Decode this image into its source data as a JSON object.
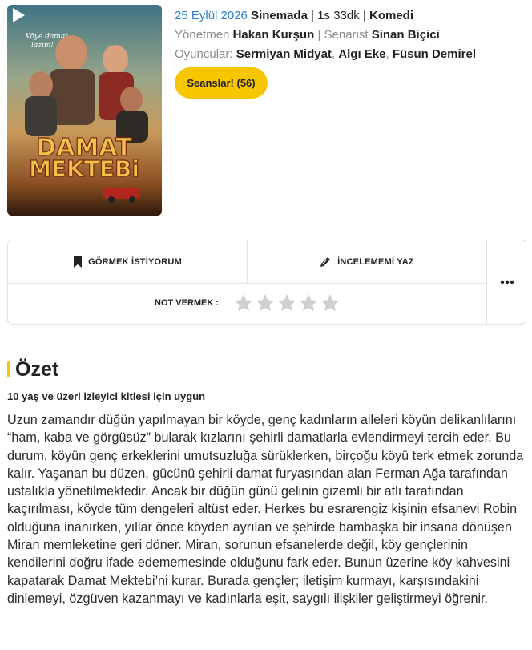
{
  "movie": {
    "poster_title_line1": "DAMAT",
    "poster_title_line2": "MEKTEBi",
    "poster_tagline": "Köye damat lazım!",
    "release_date": "25 Eylül 2026",
    "status": "Sinemada",
    "duration": "1s 33dk",
    "genre": "Komedi",
    "director_label": "Yönetmen",
    "director": "Hakan Kurşun",
    "writer_label": "Senarist",
    "writer": "Sinan Biçici",
    "cast_label": "Oyuncular:",
    "cast": [
      "Sermiyan Midyat",
      "Algı Eke",
      "Füsun Demirel"
    ],
    "sessions_button": "Seanslar! (56)"
  },
  "actions": {
    "watchlist_label": "GÖRMEK İSTİYORUM",
    "review_label": "İNCELEMEMİ YAZ",
    "rate_label": "NOT VERMEK :",
    "rating_value": 0,
    "rating_max": 5
  },
  "summary": {
    "heading": "Özet",
    "age_rating": "10 yaş ve üzeri izleyici kitlesi için uygun",
    "text": "Uzun zamandır düğün yapılmayan bir köyde, genç kadınların aileleri köyün delikanlılarını “ham, kaba ve görgüsüz” bularak kızlarını şehirli damatlarla evlendirmeyi tercih eder. Bu durum, köyün genç erkeklerini umutsuzluğa sürüklerken, birçoğu köyü terk etmek zorunda kalır. Yaşanan bu düzen, gücünü şehirli damat furyasından alan Ferman Ağa tarafından ustalıkla yönetilmektedir. Ancak bir düğün günü gelinin gizemli bir atlı tarafından kaçırılması, köyde tüm dengeleri altüst eder. Herkes bu esrarengiz kişinin efsanevi Robin olduğuna inanırken, yıllar önce köyden ayrılan ve şehirde bambaşka bir insana dönüşen Miran memleketine geri döner. Miran, sorunun efsanelerde değil, köy gençlerinin kendilerini doğru ifade edememesinde olduğunu fark eder. Bunun üzerine köy kahvesini kapatarak Damat Mektebi’ni kurar. Burada gençler; iletişim kurmayı, karşısındakini dinlemeyi, özgüven kazanmayı ve kadınlarla eşit, saygılı ilişkiler geliştirmeyi öğrenir."
  },
  "colors": {
    "accent_yellow": "#f7c600",
    "link_blue": "#2a7fc8",
    "muted_gray": "#8a8a8a",
    "star_gray": "#cfcfcf"
  }
}
